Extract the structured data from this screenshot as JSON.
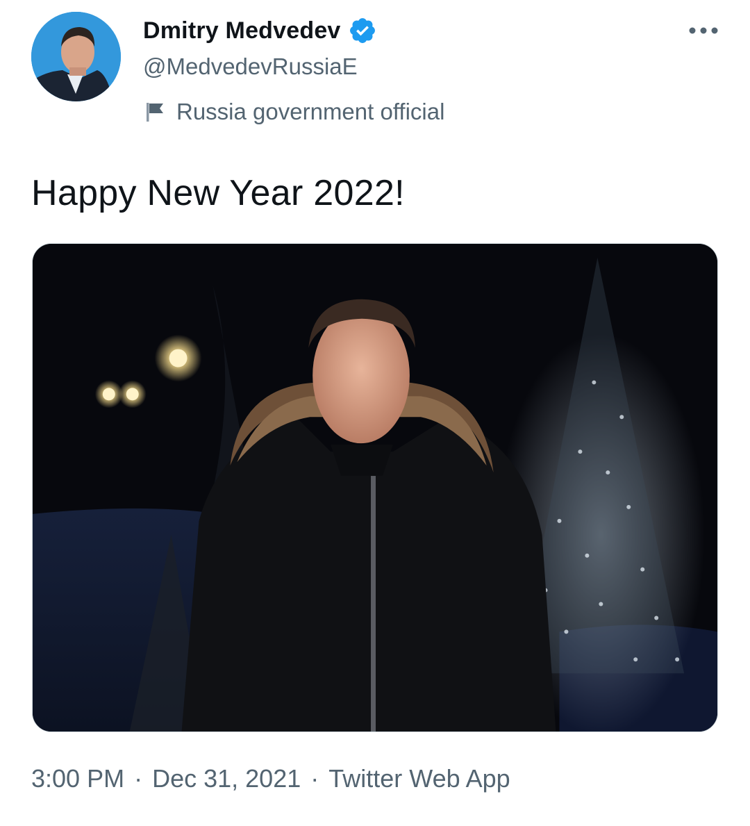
{
  "author": {
    "display_name": "Dmitry Medvedev",
    "handle": "@MedvedevRussiaE",
    "label": "Russia government official",
    "verified": true,
    "avatar_icon": "profile-photo",
    "verified_icon": "verified-badge-icon",
    "label_icon": "flag-icon"
  },
  "menu": {
    "icon": "more-horizontal-icon"
  },
  "tweet": {
    "text": "Happy New Year 2022!",
    "media": {
      "type": "photo",
      "description_icon": "photo"
    }
  },
  "meta": {
    "time": "3:00 PM",
    "separator": "·",
    "date": "Dec 31, 2021",
    "source": "Twitter Web App"
  },
  "colors": {
    "text_primary": "#0f1419",
    "text_secondary": "#536471",
    "verified_blue": "#1d9bf0",
    "border": "#cfd9de"
  }
}
